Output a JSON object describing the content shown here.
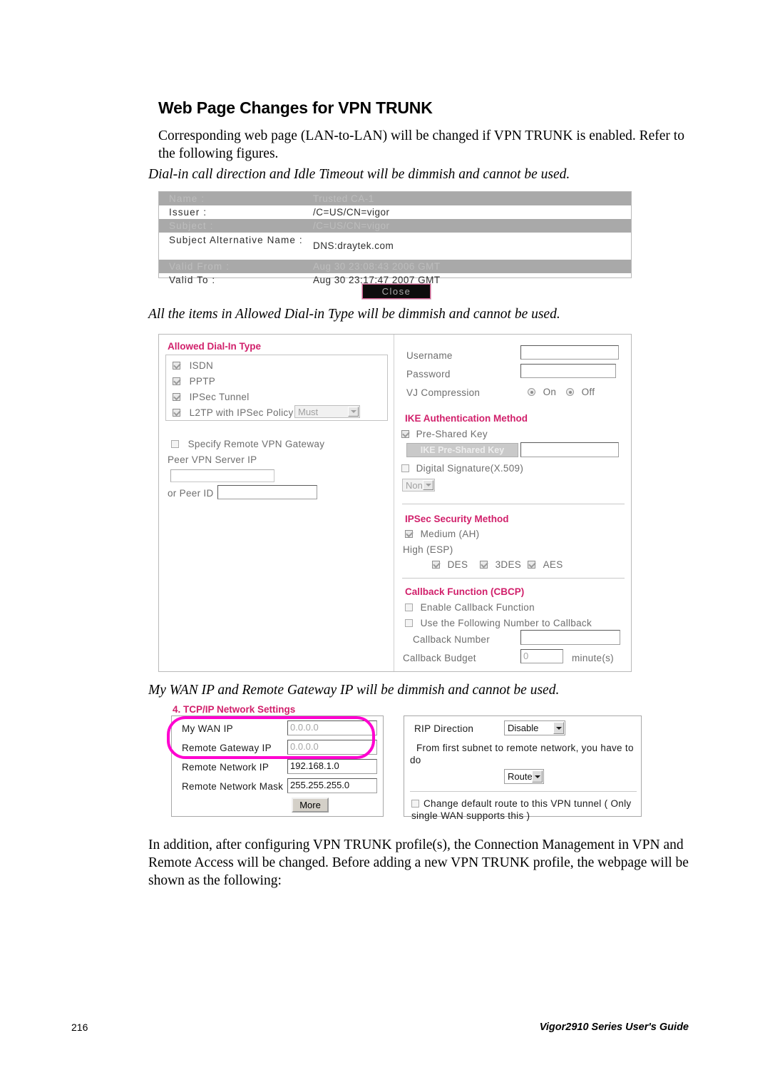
{
  "document": {
    "heading": "Web Page Changes for VPN TRUNK",
    "intro": "Corresponding web page (LAN-to-LAN) will be changed if VPN TRUNK is enabled. Refer to the following figures.",
    "caption_1": "Dial-in call direction and Idle Timeout will be dimmish and cannot be used.",
    "caption_2": "All the items in Allowed Dial-in Type will be dimmish and cannot be used.",
    "caption_3": "My WAN IP and Remote Gateway IP will be dimmish and cannot be used.",
    "closing": "In addition, after configuring VPN TRUNK profile(s), the Connection Management in VPN and Remote Access will be changed. Before adding a new VPN TRUNK profile, the webpage will be shown as the following:",
    "footer": {
      "page_number": "216",
      "guide_title": "Vigor2910 Series User's Guide"
    }
  },
  "figure_certificate": {
    "rows": [
      {
        "key": "Name :",
        "value": "Trusted CA-1",
        "dimmed": true
      },
      {
        "key": "Issuer :",
        "value": "/C=US/CN=vigor",
        "dimmed": false
      },
      {
        "key": "Subject :",
        "value": "/C=US/CN=vigor",
        "dimmed": true
      },
      {
        "key": "Subject Alternative Name :",
        "value": "DNS:draytek.com",
        "dimmed": false
      },
      {
        "key": "Valid From :",
        "value": "Aug 30 23:08:43 2006 GMT",
        "dimmed": true
      },
      {
        "key": "Valid To :",
        "value": "Aug 30 23:17:47 2007 GMT",
        "dimmed": false
      }
    ],
    "close_button": "Close"
  },
  "figure_dialin": {
    "section_title": "Allowed Dial-In Type",
    "dialin_types": [
      {
        "label": "ISDN",
        "checked": true
      },
      {
        "label": "PPTP",
        "checked": true
      },
      {
        "label": "IPSec Tunnel",
        "checked": true
      },
      {
        "label": "L2TP with IPSec Policy",
        "checked": true
      }
    ],
    "l2tp_policy_value": "Must",
    "specify_gateway_label": "Specify Remote VPN Gateway",
    "peer_vpn_server_ip_label": "Peer VPN Server IP",
    "peer_vpn_server_ip_value": "",
    "or_peer_id_label": "or Peer ID",
    "or_peer_id_value": "",
    "username_label": "Username",
    "username_value": "",
    "password_label": "Password",
    "password_value": "",
    "vj_compression_label": "VJ Compression",
    "vj_on_label": "On",
    "vj_off_label": "Off",
    "ike_section_title": "IKE Authentication Method",
    "pre_shared_key_label": "Pre-Shared Key",
    "ike_pre_shared_key_button": "IKE Pre-Shared Key",
    "ike_pre_shared_key_value": "",
    "digital_signature_label": "Digital Signature(X.509)",
    "digital_signature_select": "None",
    "ipsec_section_title": "IPSec Security Method",
    "medium_ah_label": "Medium (AH)",
    "high_esp_label": "High (ESP)",
    "esp_options": [
      {
        "label": "DES",
        "checked": true
      },
      {
        "label": "3DES",
        "checked": true
      },
      {
        "label": "AES",
        "checked": true
      }
    ],
    "callback_section_title": "Callback Function (CBCP)",
    "enable_callback_label": "Enable Callback Function",
    "use_following_number_label": "Use the Following Number to Callback",
    "callback_number_label": "Callback Number",
    "callback_number_value": "",
    "callback_budget_label": "Callback Budget",
    "callback_budget_value": "0",
    "minutes_label": "minute(s)"
  },
  "figure_tcpip": {
    "section_title": "4. TCP/IP Network Settings",
    "fields": [
      {
        "label": "My WAN IP",
        "value": "0.0.0.0",
        "dimmed": true
      },
      {
        "label": "Remote Gateway IP",
        "value": "0.0.0.0",
        "dimmed": true
      },
      {
        "label": "Remote Network IP",
        "value": "192.168.1.0",
        "dimmed": false
      },
      {
        "label": "Remote Network Mask",
        "value": "255.255.255.0",
        "dimmed": false
      }
    ],
    "more_button": "More",
    "rip_direction_label": "RIP Direction",
    "rip_direction_value": "Disable",
    "subnet_note": "From first subnet to remote network, you have to do",
    "route_value": "Route",
    "change_default_route_label": "Change default route to this VPN tunnel ( Only single WAN supports this )",
    "highlight_color": "#ff00d0"
  }
}
